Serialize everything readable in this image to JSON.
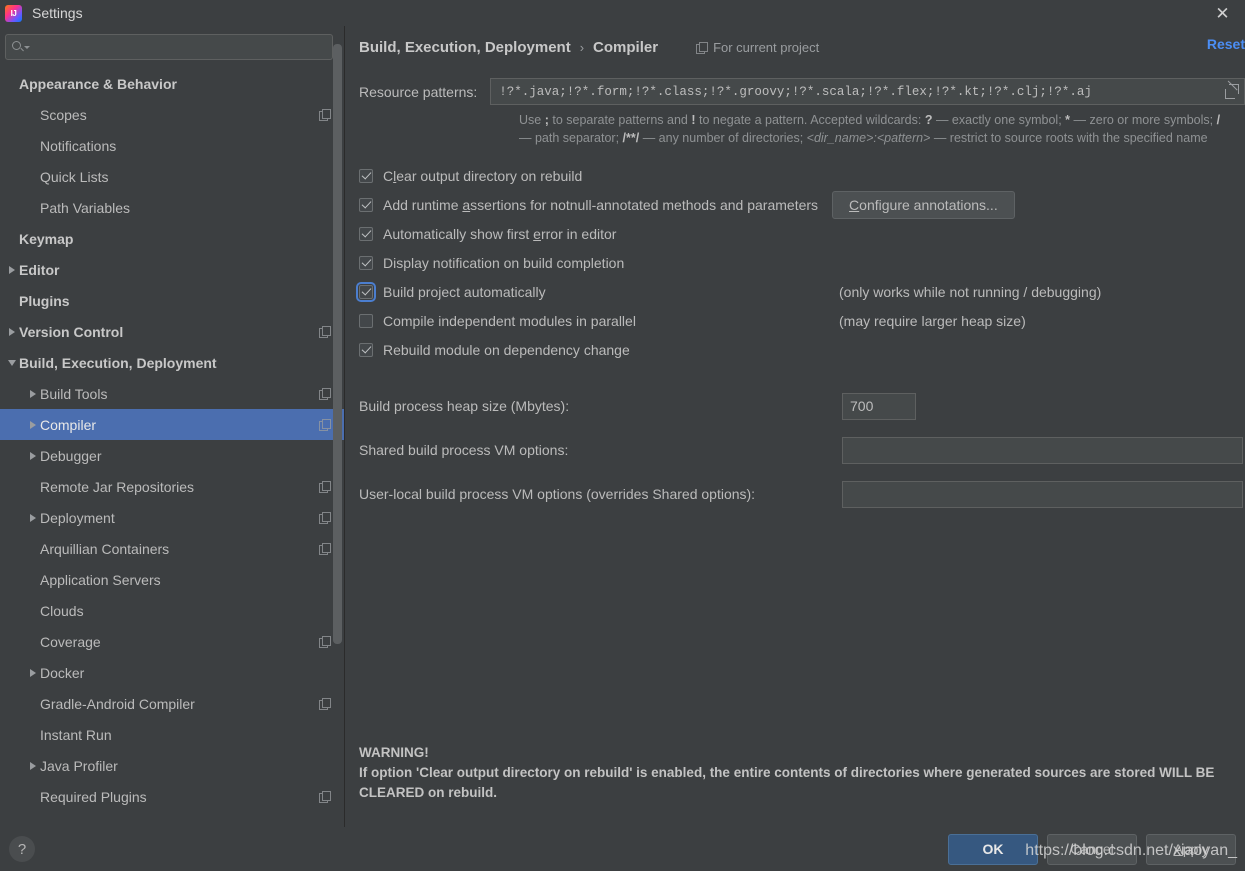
{
  "window": {
    "title": "Settings",
    "app_icon": "intellij-idea-icon",
    "close_icon": "close-icon"
  },
  "search": {
    "value": "",
    "placeholder": "",
    "icon": "search-icon"
  },
  "sidebar": {
    "items": [
      {
        "label": "Appearance & Behavior",
        "level": 0,
        "bold": true,
        "arrow": "none",
        "badge": false
      },
      {
        "label": "Scopes",
        "level": 1,
        "bold": false,
        "arrow": "none",
        "badge": true
      },
      {
        "label": "Notifications",
        "level": 1,
        "bold": false,
        "arrow": "none",
        "badge": false
      },
      {
        "label": "Quick Lists",
        "level": 1,
        "bold": false,
        "arrow": "none",
        "badge": false
      },
      {
        "label": "Path Variables",
        "level": 1,
        "bold": false,
        "arrow": "none",
        "badge": false
      },
      {
        "label": "Keymap",
        "level": 0,
        "bold": true,
        "arrow": "none",
        "badge": false
      },
      {
        "label": "Editor",
        "level": 0,
        "bold": true,
        "arrow": "right",
        "badge": false
      },
      {
        "label": "Plugins",
        "level": 0,
        "bold": true,
        "arrow": "none",
        "badge": false
      },
      {
        "label": "Version Control",
        "level": 0,
        "bold": true,
        "arrow": "right",
        "badge": true
      },
      {
        "label": "Build, Execution, Deployment",
        "level": 0,
        "bold": true,
        "arrow": "down",
        "badge": false
      },
      {
        "label": "Build Tools",
        "level": 1,
        "bold": false,
        "arrow": "right",
        "badge": true
      },
      {
        "label": "Compiler",
        "level": 1,
        "bold": false,
        "arrow": "right",
        "badge": true,
        "selected": true
      },
      {
        "label": "Debugger",
        "level": 1,
        "bold": false,
        "arrow": "right",
        "badge": false
      },
      {
        "label": "Remote Jar Repositories",
        "level": 1,
        "bold": false,
        "arrow": "none",
        "badge": true
      },
      {
        "label": "Deployment",
        "level": 1,
        "bold": false,
        "arrow": "right",
        "badge": true
      },
      {
        "label": "Arquillian Containers",
        "level": 1,
        "bold": false,
        "arrow": "none",
        "badge": true
      },
      {
        "label": "Application Servers",
        "level": 1,
        "bold": false,
        "arrow": "none",
        "badge": false
      },
      {
        "label": "Clouds",
        "level": 1,
        "bold": false,
        "arrow": "none",
        "badge": false
      },
      {
        "label": "Coverage",
        "level": 1,
        "bold": false,
        "arrow": "none",
        "badge": true
      },
      {
        "label": "Docker",
        "level": 1,
        "bold": false,
        "arrow": "right",
        "badge": false
      },
      {
        "label": "Gradle-Android Compiler",
        "level": 1,
        "bold": false,
        "arrow": "none",
        "badge": true
      },
      {
        "label": "Instant Run",
        "level": 1,
        "bold": false,
        "arrow": "none",
        "badge": false
      },
      {
        "label": "Java Profiler",
        "level": 1,
        "bold": false,
        "arrow": "right",
        "badge": false
      },
      {
        "label": "Required Plugins",
        "level": 1,
        "bold": false,
        "arrow": "none",
        "badge": true
      }
    ]
  },
  "header": {
    "breadcrumb_parent": "Build, Execution, Deployment",
    "breadcrumb_separator": "›",
    "breadcrumb_current": "Compiler",
    "scope_badge_label": "For current project",
    "scope_badge_icon": "project-scope-icon",
    "reset_label": "Reset"
  },
  "resource_patterns": {
    "label": "Resource patterns:",
    "value": "!?*.java;!?*.form;!?*.class;!?*.groovy;!?*.scala;!?*.flex;!?*.kt;!?*.clj;!?*.aj",
    "placeholder": "",
    "expand_icon": "expand-icon",
    "hint_part1": "Use ",
    "hint_sep": ";",
    "hint_part2": " to separate patterns and ",
    "hint_bang": "!",
    "hint_part3": " to negate a pattern. Accepted wildcards: ",
    "hint_q": "?",
    "hint_part4": " — exactly one symbol; ",
    "hint_star": "*",
    "hint_part5": " — zero or more symbols; ",
    "hint_slash": "/",
    "hint_part6": " — path separator; ",
    "hint_globstar": "/**/",
    "hint_part7": " — any number of directories; ",
    "hint_dirpattern": "<dir_name>:<pattern>",
    "hint_part8": " — restrict to source roots with the specified name"
  },
  "checkboxes": [
    {
      "label_pre": "C",
      "mnemonic": "l",
      "label_post": "ear output directory on rebuild",
      "checked": true,
      "focused": false,
      "note": "",
      "button": null
    },
    {
      "label_pre": "Add runtime ",
      "mnemonic": "a",
      "label_post": "ssertions for notnull-annotated methods and parameters",
      "checked": true,
      "focused": false,
      "note": "",
      "button": {
        "pre": "",
        "mnemonic": "C",
        "post": "onfigure annotations..."
      }
    },
    {
      "label_pre": "Automatically show first ",
      "mnemonic": "e",
      "label_post": "rror in editor",
      "checked": true,
      "focused": false,
      "note": "",
      "button": null
    },
    {
      "label_pre": "Display notification on build completion",
      "mnemonic": "",
      "label_post": "",
      "checked": true,
      "focused": false,
      "note": "",
      "button": null
    },
    {
      "label_pre": "Build project automatically",
      "mnemonic": "",
      "label_post": "",
      "checked": true,
      "focused": true,
      "note": "(only works while not running / debugging)",
      "button": null
    },
    {
      "label_pre": "Compile independent modules in parallel",
      "mnemonic": "",
      "label_post": "",
      "checked": false,
      "focused": false,
      "note": "(may require larger heap size)",
      "button": null
    },
    {
      "label_pre": "Rebuild module on dependency change",
      "mnemonic": "",
      "label_post": "",
      "checked": true,
      "focused": false,
      "note": "",
      "button": null
    }
  ],
  "fields": {
    "heap_label": "Build process heap size (Mbytes):",
    "heap_value": "700",
    "shared_vm_label": "Shared build process VM options:",
    "shared_vm_value": "",
    "user_vm_label": "User-local build process VM options (overrides Shared options):",
    "user_vm_value": ""
  },
  "warning": {
    "title": "WARNING!",
    "body": "If option 'Clear output directory on rebuild' is enabled, the entire contents of directories where generated sources are stored WILL BE CLEARED on rebuild."
  },
  "footer": {
    "help_label": "?",
    "ok_label": "OK",
    "cancel_label": "Cancel",
    "apply_pre": "",
    "apply_mnemonic": "A",
    "apply_post": "pply"
  },
  "watermark": "https://blog.csdn.net/xiaoyan_",
  "colors": {
    "accent": "#4b6eaf",
    "link": "#4b8ef5",
    "primary_button": "#365880",
    "background": "#3c3f41",
    "field_background": "#45494a"
  }
}
